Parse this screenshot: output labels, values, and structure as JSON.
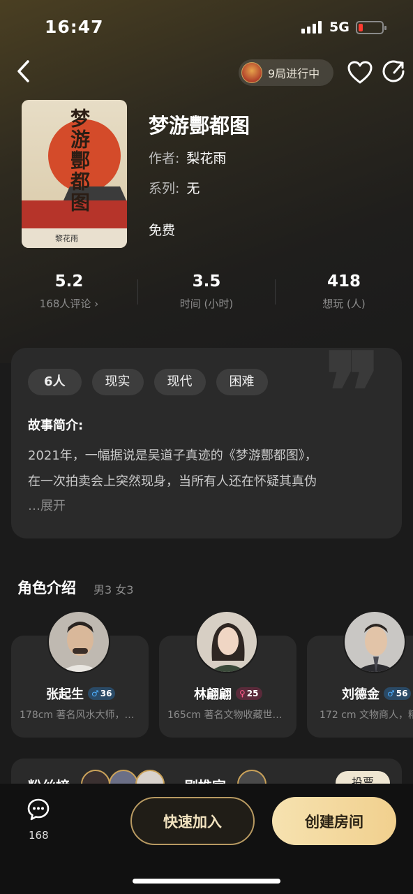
{
  "status_bar": {
    "time": "16:47",
    "network": "5G"
  },
  "nav": {
    "progress_label": "9局进行中"
  },
  "book": {
    "title": "梦游酆都图",
    "cover_title": "梦游酆都图",
    "cover_author": "黎花雨",
    "author_label": "作者:",
    "author": "梨花雨",
    "series_label": "系列:",
    "series": "无",
    "price": "免费"
  },
  "stats": [
    {
      "value": "5.2",
      "label": "168人评论 ›"
    },
    {
      "value": "3.5",
      "label": "时间 (小时)"
    },
    {
      "value": "418",
      "label": "想玩 (人)"
    }
  ],
  "story": {
    "tags": [
      "6人",
      "现实",
      "现代",
      "困难"
    ],
    "heading": "故事简介:",
    "line1": "2021年，一幅据说是吴道子真迹的《梦游酆都图》，",
    "line2": "在一次拍卖会上突然现身，当所有人还在怀疑其真伪",
    "expand": "…展开"
  },
  "roles": {
    "title": "角色介绍",
    "summary": "男3 女3",
    "items": [
      {
        "name": "张起生",
        "gender": "♂",
        "age": "36",
        "desc": "178cm 著名风水大师，…"
      },
      {
        "name": "林翩翩",
        "gender": "♀",
        "age": "25",
        "desc": "165cm 著名文物收藏世…"
      },
      {
        "name": "刘德金",
        "gender": "♂",
        "age": "56",
        "desc": "172 cm 文物商人，精"
      }
    ]
  },
  "bottom_card": {
    "fans_title": "粉丝榜",
    "rec_title": "剧推官",
    "vote_label": "投票"
  },
  "bottom_bar": {
    "chat_count": "168",
    "join_label": "快速加入",
    "create_label": "创建房间"
  },
  "colors": {
    "accent_gold": "#f1d08e",
    "female": "#ff5b8a",
    "male": "#4fb0ff"
  }
}
